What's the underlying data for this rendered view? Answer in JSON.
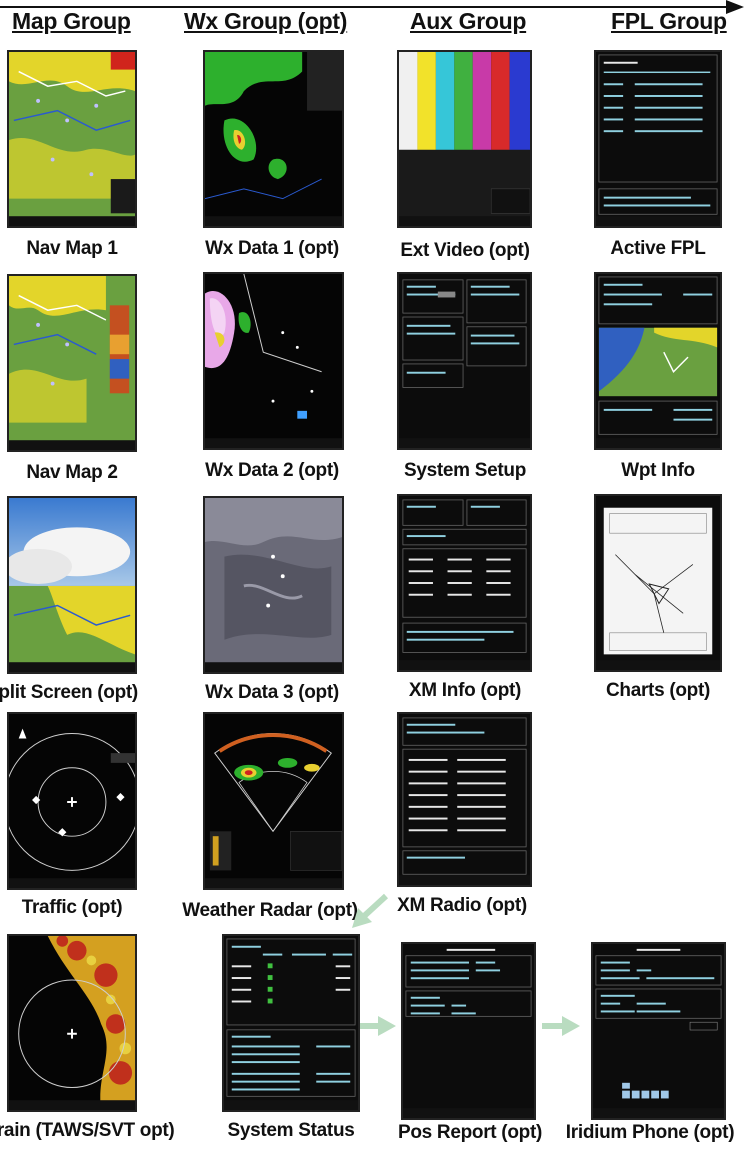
{
  "groups": {
    "map": "Map Group",
    "wx": "Wx Group (opt)",
    "aux": "Aux Group",
    "fpl": "FPL Group"
  },
  "pages": {
    "nav_map_1": "Nav Map 1",
    "nav_map_2": "Nav Map 2",
    "split_screen": "Split Screen (opt)",
    "traffic": "Traffic (opt)",
    "terrain": "Terrain (TAWS/SVT opt)",
    "wx_data_1": "Wx Data 1 (opt)",
    "wx_data_2": "Wx Data 2 (opt)",
    "wx_data_3": "Wx Data 3 (opt)",
    "weather_radar": "Weather Radar (opt)",
    "ext_video": "Ext Video (opt)",
    "system_setup": "System Setup",
    "xm_info": "XM Info (opt)",
    "xm_radio": "XM Radio (opt)",
    "system_status": "System Status",
    "pos_report": "Pos Report (opt)",
    "iridium_phone": "Iridium Phone (opt)",
    "active_fpl": "Active FPL",
    "wpt_info": "Wpt Info",
    "charts": "Charts (opt)"
  },
  "colors": {
    "flow_arrow": "#111111",
    "link_arrow": "#b9dcc0",
    "screen_bg": "#0a0a0a",
    "map_yellow": "#e6d61e",
    "map_green": "#5a9a3a",
    "screen_text": "#8fd0e0"
  }
}
